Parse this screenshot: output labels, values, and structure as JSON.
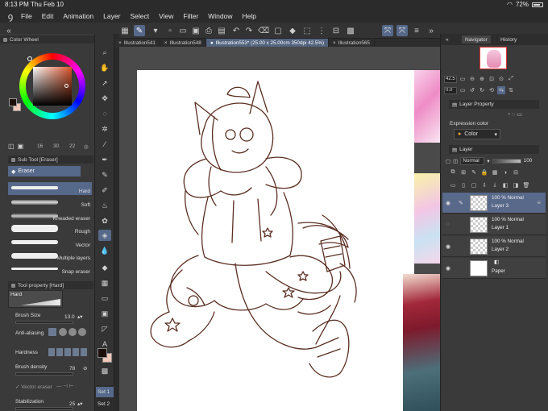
{
  "status": {
    "time": "8:13 PM",
    "date": "Thu Feb 10",
    "battery": "72%"
  },
  "menu": {
    "items": [
      "File",
      "Edit",
      "Animation",
      "Layer",
      "Select",
      "View",
      "Filter",
      "Window",
      "Help"
    ]
  },
  "tabs": [
    {
      "label": "Illustration541",
      "active": false
    },
    {
      "label": "Illustration548",
      "active": false
    },
    {
      "label": "Illustration553* (25.00 x 25.00cm 350dpi 42.5%)",
      "active": true
    },
    {
      "label": "Illustration565",
      "active": false
    }
  ],
  "colorwheel": {
    "title": "Color Wheel",
    "h": "16",
    "s": "30",
    "v": "22",
    "main_color": "#1c0e08",
    "sub_color": "#f1c6b8"
  },
  "subtool": {
    "title": "Sub Tool [Eraser]",
    "selected_tab": "Eraser",
    "brushes": [
      "Hard",
      "Soft",
      "Kneaded eraser",
      "Rough",
      "Vector",
      "Multiple layers",
      "Snap eraser"
    ],
    "selected_brush": "Hard"
  },
  "tool_property": {
    "title": "Tool property [Hard]",
    "preset": "Hard",
    "brush_size_label": "Brush Size",
    "brush_size_value": "13.0",
    "anti_aliasing_label": "Anti-aliasing",
    "hardness_label": "Hardness",
    "brush_density_label": "Brush density",
    "brush_density_value": "78",
    "vector_eraser_label": "Vector eraser",
    "stabilization_label": "Stabilization",
    "stabilization_value": "25"
  },
  "navigator": {
    "tab_navigator": "Navigator",
    "tab_history": "History",
    "zoom": "42.5",
    "rotation": "0.0"
  },
  "layer_property": {
    "title": "Layer Property",
    "expression_label": "Expression color",
    "expression_value": "Color"
  },
  "layer_panel": {
    "title": "Layer",
    "blend_mode": "Normal",
    "opacity": "100",
    "layers": [
      {
        "opacity": "100 %",
        "mode": "Normal",
        "name": "Layer 3",
        "selected": true,
        "type": "raster"
      },
      {
        "opacity": "100 %",
        "mode": "Normal",
        "name": "Layer 1",
        "selected": false,
        "type": "raster"
      },
      {
        "opacity": "100 %",
        "mode": "Normal",
        "name": "Layer 2",
        "selected": false,
        "type": "raster"
      },
      {
        "opacity": "",
        "mode": "",
        "name": "Paper",
        "selected": false,
        "type": "paper"
      }
    ]
  },
  "sets": [
    "Set 1",
    "Set 2"
  ],
  "colors": {
    "accent": "#56698a",
    "line_art": "#5a2f22"
  }
}
